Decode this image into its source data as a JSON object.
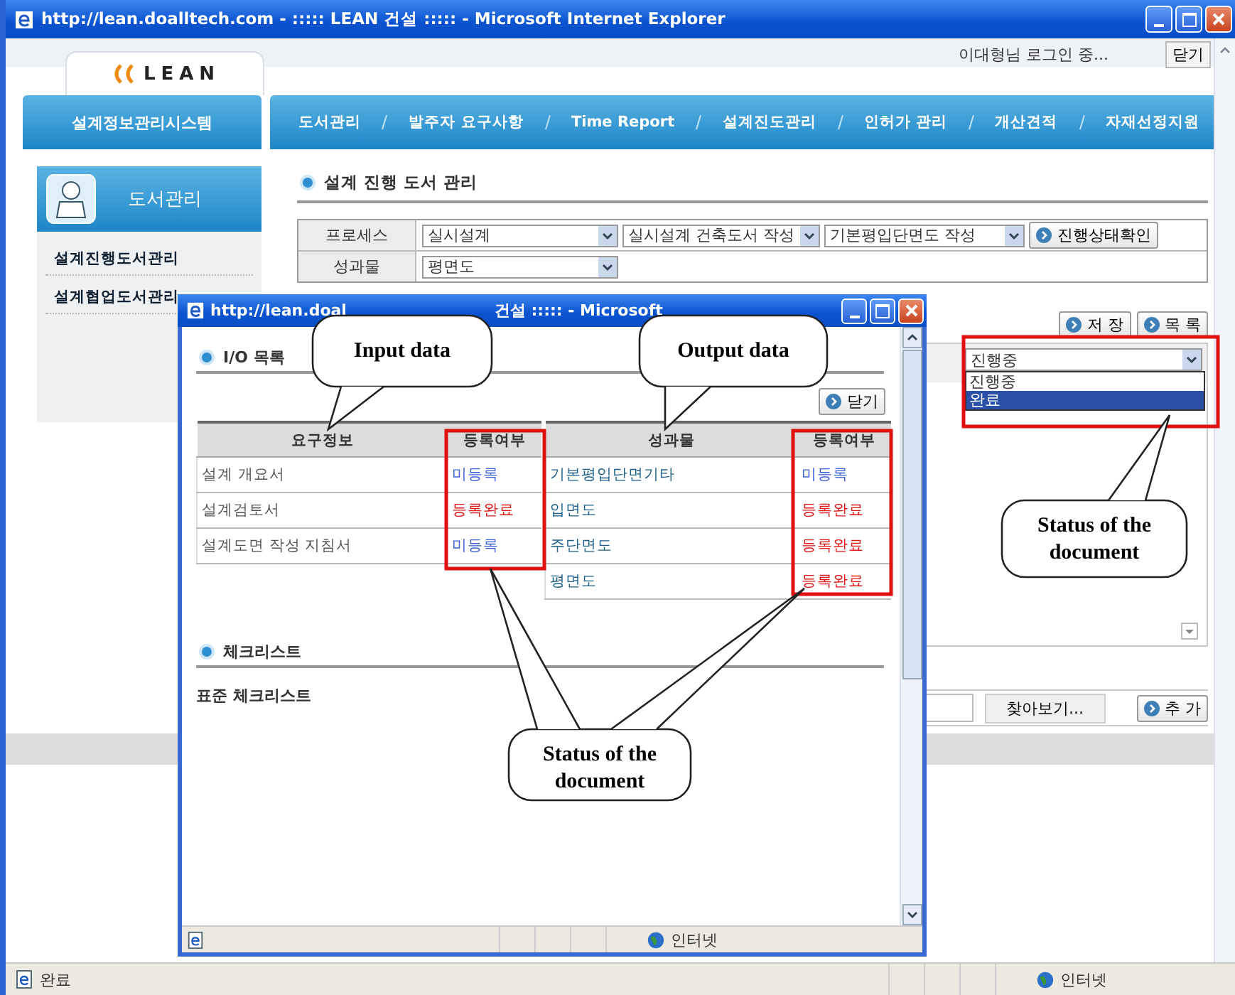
{
  "window": {
    "title": "http://lean.doalltech.com - ::::: LEAN 건설 ::::: - Microsoft Internet Explorer"
  },
  "header": {
    "logo": "LEAN",
    "user": "이대형님 로그인 중...",
    "close_button": "닫기"
  },
  "system_name": "설계정보관리시스템",
  "nav": [
    "도서관리",
    "발주자 요구사항",
    "Time Report",
    "설계진도관리",
    "인허가 관리",
    "개산견적",
    "자재선정지원"
  ],
  "sidebar": {
    "title": "도서관리",
    "items": [
      "설계진행도서관리",
      "설계협업도서관리"
    ]
  },
  "section_title": "설계 진행 도서 관리",
  "form": [
    {
      "label": "프로세스",
      "selects": [
        "실시설계",
        "실시설계 건축도서 작성",
        "기본평입단면도 작성"
      ],
      "button": "진행상태확인"
    },
    {
      "label": "성과물",
      "selects": [
        "평면도"
      ]
    }
  ],
  "actions": [
    "저 장",
    "목 록"
  ],
  "status_select": {
    "value": "진행중",
    "expanded": true,
    "options": [
      {
        "label": "진행중",
        "highlighted": false
      },
      {
        "label": "완료",
        "highlighted": true
      }
    ]
  },
  "file_row": {
    "browse": "찾아보기...",
    "add": "추 가"
  },
  "status_bar": {
    "text": "완료",
    "zone": "인터넷"
  },
  "popup": {
    "title_parts": [
      "http://lean.doal",
      "건설 ::::: - Microsoft"
    ],
    "io_title": "I/O 목록",
    "close_button": "닫기",
    "inputs": {
      "columns": [
        "요구정보",
        "등록여부"
      ],
      "rows": [
        {
          "name": "설계 개요서",
          "status": "미등록",
          "registered": false
        },
        {
          "name": "설계검토서",
          "status": "등록완료",
          "registered": true
        },
        {
          "name": "설계도면 작성 지침서",
          "status": "미등록",
          "registered": false
        }
      ]
    },
    "outputs": {
      "columns": [
        "성과물",
        "등록여부"
      ],
      "rows": [
        {
          "name": "기본평입단면기타",
          "status": "미등록",
          "registered": false
        },
        {
          "name": "입면도",
          "status": "등록완료",
          "registered": true
        },
        {
          "name": "주단면도",
          "status": "등록완료",
          "registered": true
        },
        {
          "name": "평면도",
          "status": "등록완료",
          "registered": true
        }
      ]
    },
    "checklist_title": "체크리스트",
    "checklist_subtitle": "표준 체크리스트",
    "status_bar": {
      "zone": "인터넷"
    }
  },
  "annotations": [
    {
      "lines": [
        "Input data"
      ]
    },
    {
      "lines": [
        "Output data"
      ]
    },
    {
      "lines": [
        "Status of the",
        "document"
      ]
    },
    {
      "lines": [
        "Status of the",
        "document"
      ]
    }
  ]
}
